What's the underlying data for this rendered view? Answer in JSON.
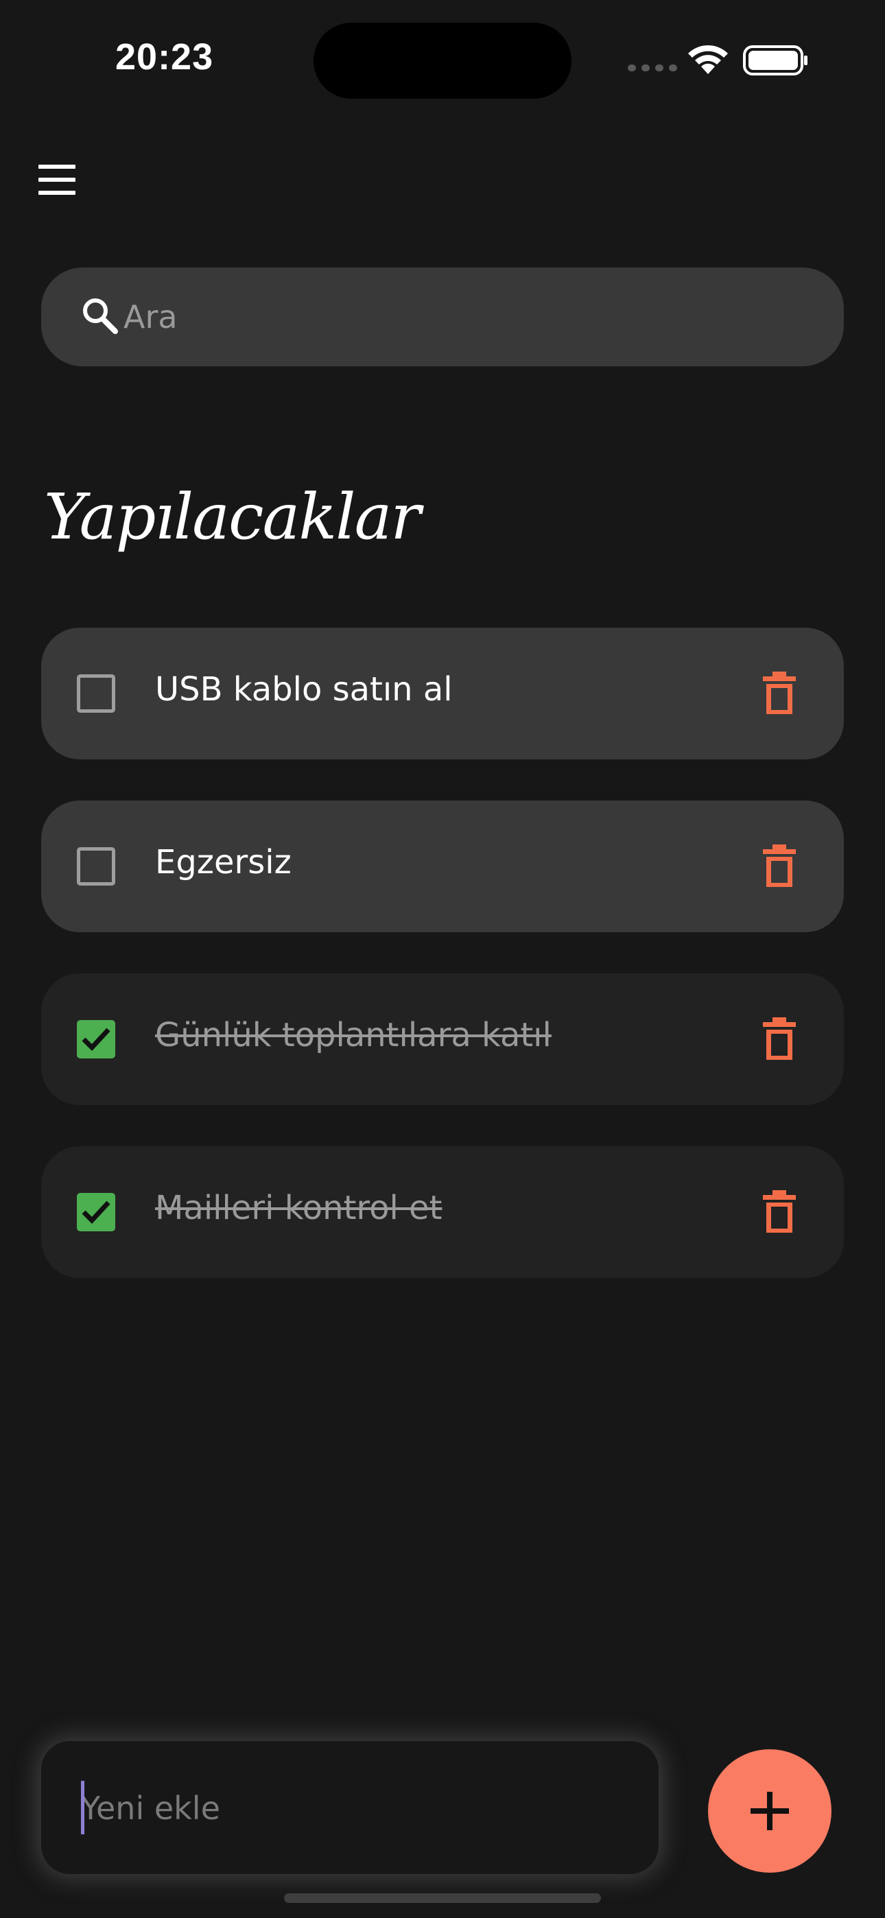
{
  "status_bar": {
    "time": "20:23"
  },
  "search": {
    "placeholder": "Ara",
    "icon": "search-icon"
  },
  "heading": "Yapılacaklar",
  "todos": [
    {
      "label": "USB kablo satın al",
      "done": false
    },
    {
      "label": "Egzersiz",
      "done": false
    },
    {
      "label": "Günlük toplantılara katıl",
      "done": true
    },
    {
      "label": "Mailleri kontrol et",
      "done": true
    }
  ],
  "new_item": {
    "placeholder": "Yeni ekle",
    "add_icon": "plus-icon"
  },
  "colors": {
    "background": "#171717",
    "card": "#393939",
    "card_done": "#222222",
    "accent": "#f97c63",
    "delete": "#f26d47",
    "check": "#4caf50"
  }
}
